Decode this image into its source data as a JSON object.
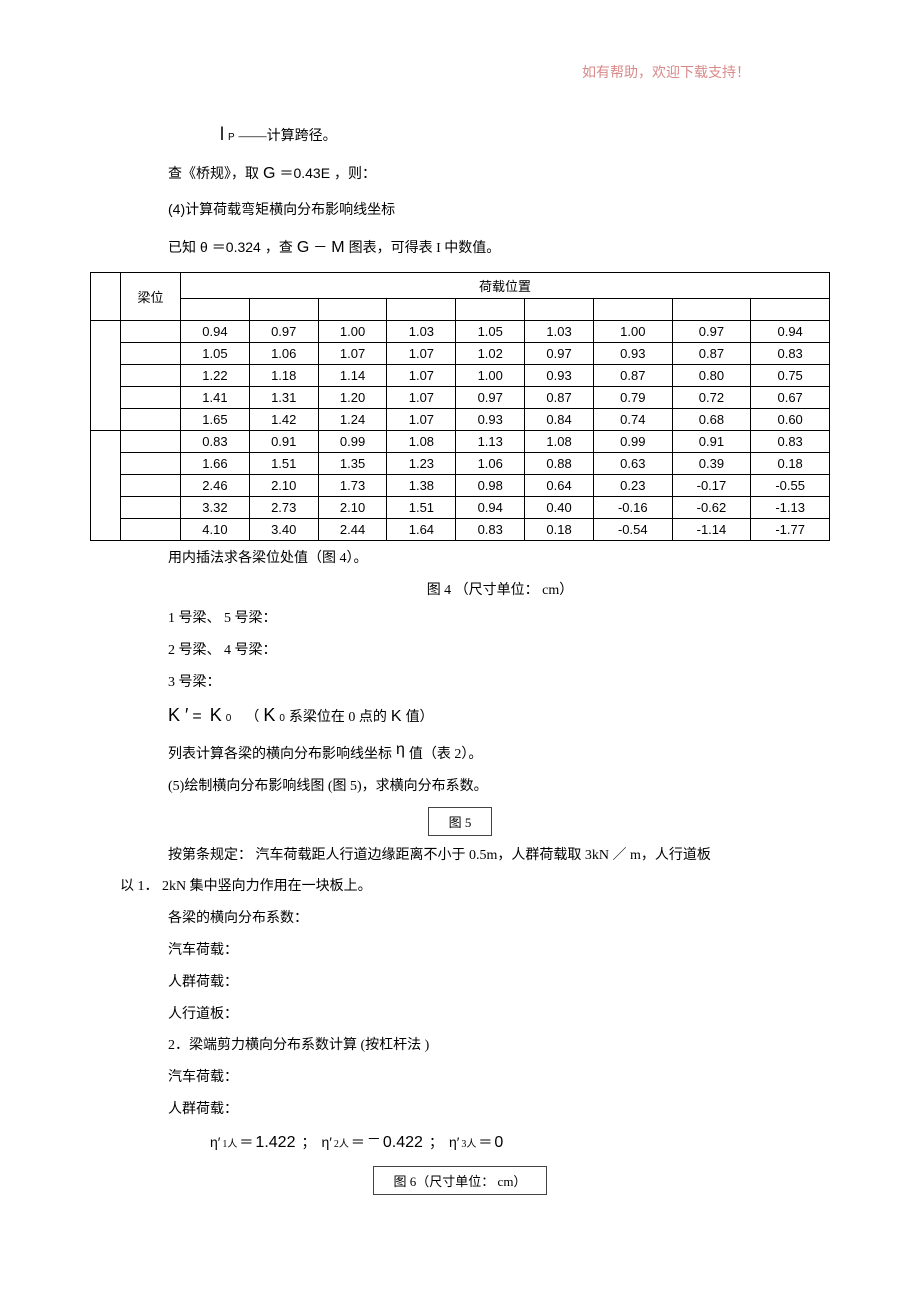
{
  "header_note": "如有帮助，欢迎下载支持！",
  "sec1": {
    "lp_label_l": "l",
    "lp_label_p": "P",
    "lp_desc": " ——计算跨径。",
    "bridge_spec": "查《桥规》，取 ",
    "g_label": "G",
    "eq_g": " ＝0.43E ",
    "then": "，则：",
    "step4": "(4)计算荷载弯矩横向分布影响线坐标",
    "given": "已知 ",
    "theta": "θ",
    "eq_theta": "＝0.324 ",
    "lookup": "，查 ",
    "g2": "G",
    "dash": " － ",
    "m": "M",
    "chart_text": " 图表，可得表   I 中数值。"
  },
  "table": {
    "beam_col_header": "梁位",
    "load_pos_header": "荷载位置",
    "rows": [
      {
        "cells": [
          "0.94",
          "0.97",
          "1.00",
          "1.03",
          "1.05",
          "1.03",
          "1.00",
          "0.97",
          "0.94"
        ]
      },
      {
        "cells": [
          "1.05",
          "1.06",
          "1.07",
          "1.07",
          "1.02",
          "0.97",
          "0.93",
          "0.87",
          "0.83"
        ]
      },
      {
        "cells": [
          "1.22",
          "1.18",
          "1.14",
          "1.07",
          "1.00",
          "0.93",
          "0.87",
          "0.80",
          "0.75"
        ]
      },
      {
        "cells": [
          "1.41",
          "1.31",
          "1.20",
          "1.07",
          "0.97",
          "0.87",
          "0.79",
          "0.72",
          "0.67"
        ]
      },
      {
        "cells": [
          "1.65",
          "1.42",
          "1.24",
          "1.07",
          "0.93",
          "0.84",
          "0.74",
          "0.68",
          "0.60"
        ]
      },
      {
        "cells": [
          "0.83",
          "0.91",
          "0.99",
          "1.08",
          "1.13",
          "1.08",
          "0.99",
          "0.91",
          "0.83"
        ]
      },
      {
        "cells": [
          "1.66",
          "1.51",
          "1.35",
          "1.23",
          "1.06",
          "0.88",
          "0.63",
          "0.39",
          "0.18"
        ]
      },
      {
        "cells": [
          "2.46",
          "2.10",
          "1.73",
          "1.38",
          "0.98",
          "0.64",
          "0.23",
          "-0.17",
          "-0.55"
        ]
      },
      {
        "cells": [
          "3.32",
          "2.73",
          "2.10",
          "1.51",
          "0.94",
          "0.40",
          "-0.16",
          "-0.62",
          "-1.13"
        ]
      },
      {
        "cells": [
          "4.10",
          "3.40",
          "2.44",
          "1.64",
          "0.83",
          "0.18",
          "-0.54",
          "-1.14",
          "-1.77"
        ]
      }
    ]
  },
  "after_table": {
    "interp": "用内插法求各梁位处值（图     4）。",
    "fig4": "图 4    （尺寸单位：  cm）",
    "beam15": "1 号梁、 5 号梁：",
    "beam24": "2 号梁、 4 号梁：",
    "beam3": "3 号梁：",
    "k_prime": "K ′",
    "eq": "=",
    "k0a": "K",
    "zero": "0",
    "paren_open": "（",
    "k0_desc": " 系梁位在 0 点的 ",
    "k_lbl": "K",
    "k0_desc2": " 值）",
    "list_calc": "列表计算各梁的横向分布影响线坐标      ",
    "eta": "η",
    "list_calc2": "值（表  2）。",
    "step5": "(5)绘制横向分布影响线图    (图 5)，求横向分布系数。",
    "fig5": "图 5",
    "clause": "按第条规定：  汽车荷载距人行道边缘距离不小于       0.5m，人群荷载取   3kN ／ m，人行道板",
    "clause2": "以 1．  2kN 集中竖向力作用在一块板上。",
    "coeff_list": "各梁的横向分布系数：",
    "auto_load": "汽车荷载：",
    "crowd_load": "人群荷载：",
    "sidewalk": "人行道板：",
    "shear": "2．梁端剪力横向分布系数计算     (按杠杆法 )",
    "auto_load2": "汽车荷载：",
    "crowd_load2": "人群荷载：",
    "eta_p": "η′",
    "sub1": "1人",
    "eq_sym": "＝",
    "val1": "1.422",
    "semi": "；",
    "sub2": "2人",
    "neg": "－",
    "val2": "0.422",
    "sub3": "3人",
    "val3": "0",
    "fig6": "图 6（尺寸单位：  cm）"
  },
  "chart_data": {
    "type": "table",
    "title": "荷载位置 (Load position) — 横向分布影响线坐标",
    "row_group": "梁位",
    "columns_count": 9,
    "rows": [
      [
        0.94,
        0.97,
        1.0,
        1.03,
        1.05,
        1.03,
        1.0,
        0.97,
        0.94
      ],
      [
        1.05,
        1.06,
        1.07,
        1.07,
        1.02,
        0.97,
        0.93,
        0.87,
        0.83
      ],
      [
        1.22,
        1.18,
        1.14,
        1.07,
        1.0,
        0.93,
        0.87,
        0.8,
        0.75
      ],
      [
        1.41,
        1.31,
        1.2,
        1.07,
        0.97,
        0.87,
        0.79,
        0.72,
        0.67
      ],
      [
        1.65,
        1.42,
        1.24,
        1.07,
        0.93,
        0.84,
        0.74,
        0.68,
        0.6
      ],
      [
        0.83,
        0.91,
        0.99,
        1.08,
        1.13,
        1.08,
        0.99,
        0.91,
        0.83
      ],
      [
        1.66,
        1.51,
        1.35,
        1.23,
        1.06,
        0.88,
        0.63,
        0.39,
        0.18
      ],
      [
        2.46,
        2.1,
        1.73,
        1.38,
        0.98,
        0.64,
        0.23,
        -0.17,
        -0.55
      ],
      [
        3.32,
        2.73,
        2.1,
        1.51,
        0.94,
        0.4,
        -0.16,
        -0.62,
        -1.13
      ],
      [
        4.1,
        3.4,
        2.44,
        1.64,
        0.83,
        0.18,
        -0.54,
        -1.14,
        -1.77
      ]
    ]
  }
}
